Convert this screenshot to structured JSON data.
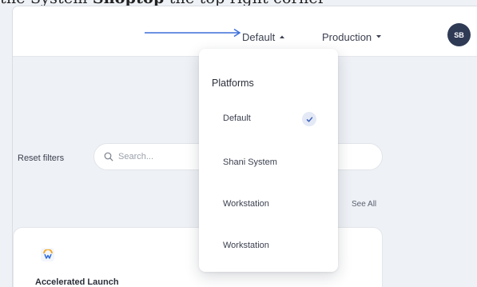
{
  "caption": {
    "text_before": "the",
    "text_system": "System",
    "text_bold": "Shoptop",
    "text_after": "the top right corner"
  },
  "header": {
    "platform_label": "Default",
    "environment_label": "Production",
    "avatar_initials": "SB"
  },
  "filters": {
    "reset_label": "Reset filters",
    "search_placeholder": "Search..."
  },
  "section": {
    "see_all_label": "See All"
  },
  "card": {
    "title": "Accelerated Launch"
  },
  "dropdown": {
    "title": "Platforms",
    "items": [
      {
        "label": "Default",
        "selected": true
      },
      {
        "label": "Shani System",
        "selected": false
      },
      {
        "label": "Workstation",
        "selected": false
      },
      {
        "label": "Workstation",
        "selected": false
      }
    ]
  },
  "colors": {
    "accent_blue": "#3b6fd8",
    "avatar_bg": "#2f3a55",
    "check_bg": "#e4e9f6"
  }
}
